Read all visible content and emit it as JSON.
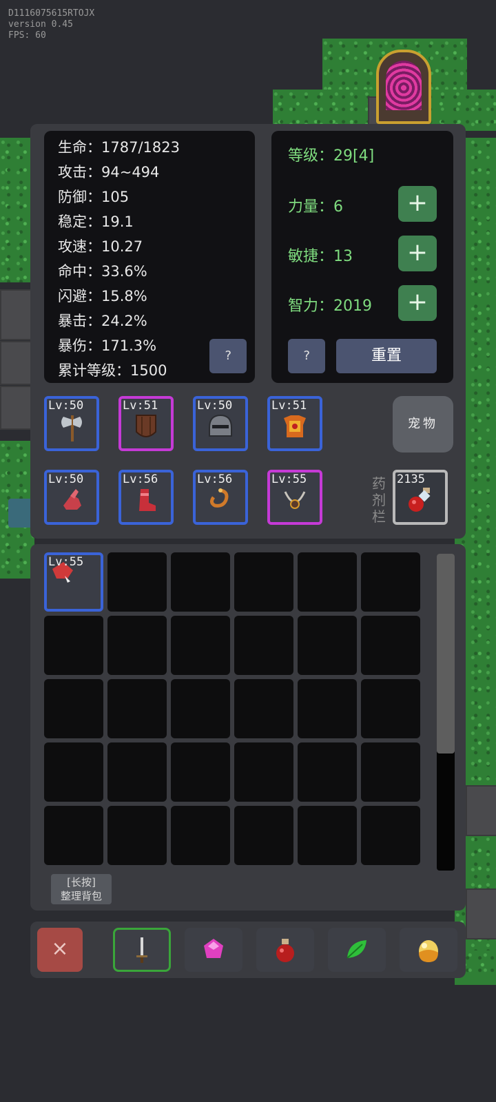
{
  "debug": {
    "id": "D1116075615RTOJX",
    "version": "version 0.45",
    "fps": "FPS: 60"
  },
  "stats": [
    {
      "label": "生命",
      "value": "1787/1823"
    },
    {
      "label": "攻击",
      "value": "94~494"
    },
    {
      "label": "防御",
      "value": "105"
    },
    {
      "label": "稳定",
      "value": "19.1"
    },
    {
      "label": "攻速",
      "value": "10.27"
    },
    {
      "label": "命中",
      "value": "33.6%"
    },
    {
      "label": "闪避",
      "value": "15.8%"
    },
    {
      "label": "暴击",
      "value": "24.2%"
    },
    {
      "label": "暴伤",
      "value": "171.3%"
    },
    {
      "label": "累计等级",
      "value": "1500"
    }
  ],
  "stats_help": "?",
  "attributes": {
    "level_label": "等级",
    "level_value": "29[4]",
    "strength_label": "力量",
    "strength_value": "6",
    "agility_label": "敏捷",
    "agility_value": "13",
    "intellect_label": "智力",
    "intellect_value": "2019",
    "plus": "+",
    "help": "?",
    "reset": "重置"
  },
  "equipment": [
    {
      "level": "Lv:50",
      "rarity": "blue",
      "icon": "axe-icon"
    },
    {
      "level": "Lv:51",
      "rarity": "purple",
      "icon": "shield-icon"
    },
    {
      "level": "Lv:50",
      "rarity": "blue",
      "icon": "helmet-icon"
    },
    {
      "level": "Lv:51",
      "rarity": "blue",
      "icon": "armor-icon"
    },
    {
      "level": "Lv:50",
      "rarity": "blue",
      "icon": "gloves-icon"
    },
    {
      "level": "Lv:56",
      "rarity": "blue",
      "icon": "boots-icon"
    },
    {
      "level": "Lv:56",
      "rarity": "blue",
      "icon": "ring-icon"
    },
    {
      "level": "Lv:55",
      "rarity": "purple",
      "icon": "necklace-icon"
    }
  ],
  "pet_button": "宠物",
  "potion_label": "药剂栏",
  "potion": {
    "count": "2135",
    "icon": "red-potion-icon"
  },
  "inventory": {
    "items": [
      {
        "level": "Lv:55",
        "rarity": "blue",
        "icon": "gauntlet-icon"
      }
    ],
    "scroll_fraction": 0.63,
    "sort_line1": "[长按]",
    "sort_line2": "整理背包"
  },
  "tabs": [
    {
      "icon": "sword-icon",
      "active": true
    },
    {
      "icon": "gem-icon",
      "active": false
    },
    {
      "icon": "potion-icon",
      "active": false
    },
    {
      "icon": "leaf-icon",
      "active": false
    },
    {
      "icon": "egg-icon",
      "active": false
    }
  ],
  "close": "×",
  "colors": {
    "blue_border": "#3a63d8",
    "purple_border": "#c53ad6",
    "attr_green": "#7fdc7f",
    "plus_green": "#3f8050",
    "close_red": "#a64a45"
  }
}
